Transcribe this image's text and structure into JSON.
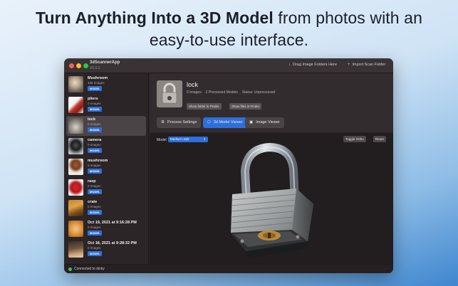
{
  "headline": {
    "bold": "Turn Anything Into a 3D Model",
    "line1_rest": " from photos with an",
    "line2": "easy-to-use interface."
  },
  "window": {
    "app_title": "3dScannerApp",
    "app_version": "V1.0.1",
    "drag_button": "Drag Image Folders Here",
    "import_button": "Import Scan Folder"
  },
  "sidebar": {
    "items": [
      {
        "name": "Mushroom",
        "count": "168 Images",
        "badge": "MODEL"
      },
      {
        "name": "pliers",
        "count": "0 Images",
        "badge": "MODEL"
      },
      {
        "name": "lock",
        "count": "0 Images",
        "badge": "MODEL"
      },
      {
        "name": "camera",
        "count": "0 Images",
        "badge": "MODEL"
      },
      {
        "name": "mushroom",
        "count": "0 Images",
        "badge": "MODEL"
      },
      {
        "name": "rasp",
        "count": "0 Images",
        "badge": "MODEL"
      },
      {
        "name": "crate",
        "count": "0 Images",
        "badge": "MODEL"
      },
      {
        "name": "Oct 19, 2021 at 9:16:28 PM",
        "count": "0 Images",
        "badge": "MODEL"
      },
      {
        "name": "Oct 18, 2021 at 9:28:32 PM",
        "count": "0 Images",
        "badge": "MODEL"
      }
    ],
    "selected_index": 2
  },
  "main": {
    "title": "lock",
    "images": "0 Images",
    "processed": "2 Processed Models",
    "status": "Status: Unprocessed",
    "show_folder": "Show folder in Finder",
    "show_files": "Show files in Finder",
    "tabs": [
      {
        "label": "Process Settings",
        "icon": "gear-icon"
      },
      {
        "label": "3d Model Viewer",
        "icon": "cube-icon"
      },
      {
        "label": "Image Viewer",
        "icon": "image-icon"
      }
    ]
  },
  "viewer": {
    "model_label": "Model",
    "model_value": "Medium usdz",
    "toggle_ortho": "Toggle Ortho",
    "reset": "Reset"
  },
  "status": {
    "text": "Connected to dinky",
    "color": "#34c759"
  }
}
